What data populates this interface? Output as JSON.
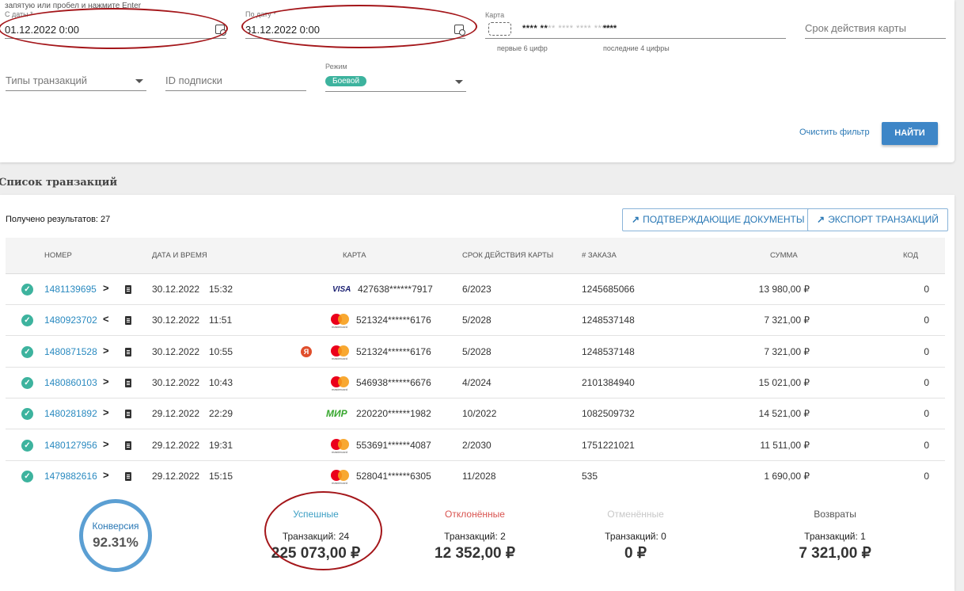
{
  "filters": {
    "hint": "запятую или пробел и нажмите Enter",
    "date_from_label": "С даты *",
    "date_from_value": "01.12.2022 0:00",
    "date_to_label": "По дату *",
    "date_to_value": "31.12.2022 0:00",
    "card_label": "Карта",
    "card_first6": "**** **",
    "card_mask_dim": "** **** **** ****",
    "card_last4": "****",
    "card_first6_caption": "первые 6 цифр",
    "card_last4_caption": "последние 4 цифры",
    "expiry_placeholder": "Срок действия карты",
    "tx_types_placeholder": "Типы транзакций",
    "subscription_placeholder": "ID подписки",
    "mode_label": "Режим",
    "mode_value": "Боевой",
    "clear_label": "Очистить фильтр",
    "find_label": "НАЙТИ"
  },
  "section_title": "Список транзакций",
  "transactions": {
    "results_label": "Получено результатов: 27",
    "confirm_docs_label": "ПОДТВЕРЖДАЮЩИЕ ДОКУМЕНТЫ",
    "export_label": "ЭКСПОРТ ТРАНЗАКЦИЙ",
    "columns": {
      "number": "НОМЕР",
      "datetime": "ДАТА И ВРЕМЯ",
      "card": "КАРТА",
      "expiry": "СРОК ДЕЙСТВИЯ КАРТЫ",
      "order": "# ЗАКАЗА",
      "amount": "СУММА",
      "code": "КОД"
    },
    "rows": [
      {
        "number": "1481139695",
        "dir": ">",
        "date": "30.12.2022",
        "time": "15:32",
        "brand": "visa",
        "card": "427638******7917",
        "expiry": "6/2023",
        "order": "1245685066",
        "amount": "13 980,00 ₽",
        "code": "0",
        "yandex": false
      },
      {
        "number": "1480923702",
        "dir": "<",
        "date": "30.12.2022",
        "time": "11:51",
        "brand": "mastercard",
        "card": "521324******6176",
        "expiry": "5/2028",
        "order": "1248537148",
        "amount": "7 321,00 ₽",
        "code": "0",
        "yandex": false
      },
      {
        "number": "1480871528",
        "dir": ">",
        "date": "30.12.2022",
        "time": "10:55",
        "brand": "mastercard",
        "card": "521324******6176",
        "expiry": "5/2028",
        "order": "1248537148",
        "amount": "7 321,00 ₽",
        "code": "0",
        "yandex": true
      },
      {
        "number": "1480860103",
        "dir": ">",
        "date": "30.12.2022",
        "time": "10:43",
        "brand": "mastercard",
        "card": "546938******6676",
        "expiry": "4/2024",
        "order": "2101384940",
        "amount": "15 021,00 ₽",
        "code": "0",
        "yandex": false
      },
      {
        "number": "1480281892",
        "dir": ">",
        "date": "29.12.2022",
        "time": "22:29",
        "brand": "mir",
        "card": "220220******1982",
        "expiry": "10/2022",
        "order": "1082509732",
        "amount": "14 521,00 ₽",
        "code": "0",
        "yandex": false
      },
      {
        "number": "1480127956",
        "dir": ">",
        "date": "29.12.2022",
        "time": "19:31",
        "brand": "mastercard",
        "card": "553691******4087",
        "expiry": "2/2030",
        "order": "1751221021",
        "amount": "11 511,00 ₽",
        "code": "0",
        "yandex": false
      },
      {
        "number": "1479882616",
        "dir": ">",
        "date": "29.12.2022",
        "time": "15:15",
        "brand": "mastercard",
        "card": "528041******6305",
        "expiry": "11/2028",
        "order": "535",
        "amount": "1 690,00 ₽",
        "code": "0",
        "yandex": false
      }
    ],
    "visa_text": "VISA",
    "mir_text": "МИР",
    "mastercard_text": "mastercard",
    "yandex_text": "Я"
  },
  "stats": {
    "conversion_label": "Конверсия",
    "conversion_value": "92.31%",
    "conversion_fraction": 0.9231,
    "successful": {
      "title": "Успешные",
      "count": "Транзакций: 24",
      "sum": "225 073,00 ₽",
      "color": "#3d9fc4"
    },
    "declined": {
      "title": "Отклонённые",
      "count": "Транзакций: 2",
      "sum": "12 352,00 ₽",
      "color": "#d9534f"
    },
    "cancelled": {
      "title": "Отменённые",
      "count": "Транзакций: 0",
      "sum": "0 ₽",
      "color": "#c8c8c8"
    },
    "refunds": {
      "title": "Возвраты",
      "count": "Транзакций: 1",
      "sum": "7 321,00 ₽",
      "color": "#555555"
    }
  },
  "colors": {
    "accent": "#3e86c7",
    "success": "#3db39e",
    "annotation": "#a4161a"
  }
}
